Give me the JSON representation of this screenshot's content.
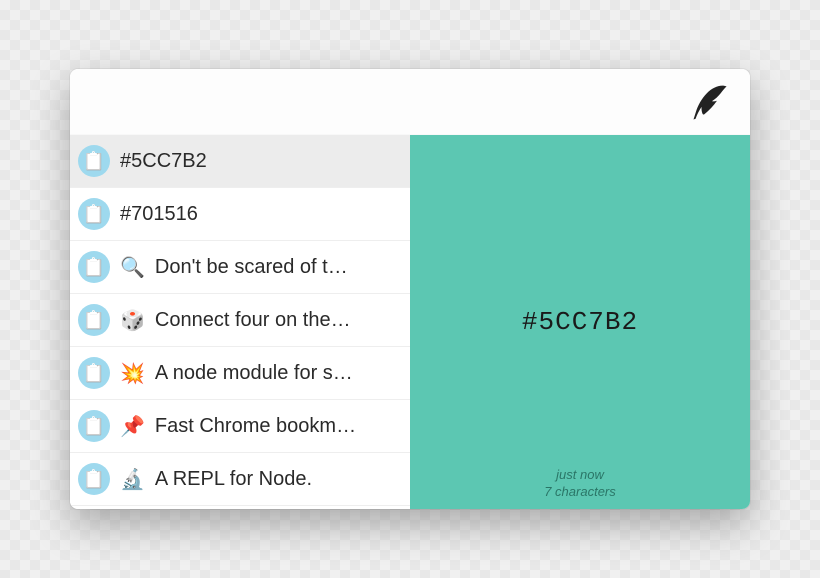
{
  "app": {
    "icon": "feather-icon"
  },
  "clipboard": {
    "items": [
      {
        "emoji": "",
        "label": "#5CC7B2",
        "selected": true
      },
      {
        "emoji": "",
        "label": "#701516"
      },
      {
        "emoji": "🔍",
        "label": "Don't be scared of t…"
      },
      {
        "emoji": "🎲",
        "label": "Connect four on the…"
      },
      {
        "emoji": "💥",
        "label": "A node module for s…"
      },
      {
        "emoji": "📌",
        "label": "Fast Chrome bookm…"
      },
      {
        "emoji": "🔬",
        "label": "A REPL for Node."
      }
    ]
  },
  "preview": {
    "content": "#5CC7B2",
    "background": "#5CC7B2",
    "meta_time": "just now",
    "meta_chars": "7 characters"
  }
}
